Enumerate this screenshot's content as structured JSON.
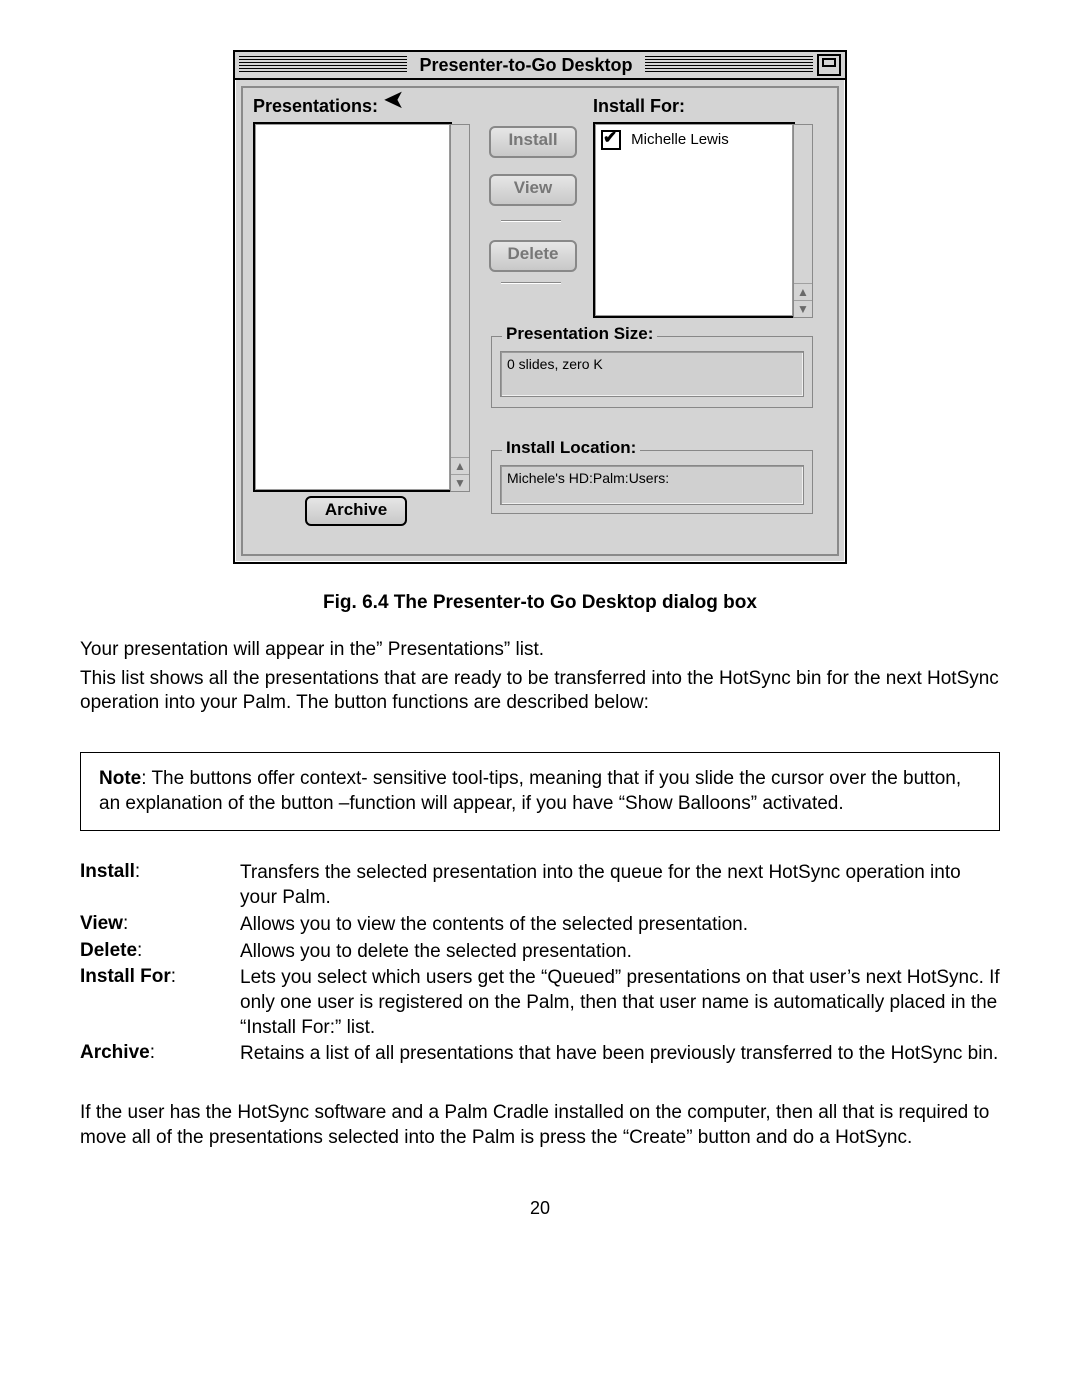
{
  "dialog": {
    "title": "Presenter-to-Go Desktop",
    "labels": {
      "presentations": "Presentations:",
      "install_for": "Install For:",
      "presentation_size": "Presentation Size:",
      "install_location": "Install Location:"
    },
    "buttons": {
      "install": "Install",
      "view": "View",
      "delete": "Delete",
      "archive": "Archive"
    },
    "install_for_user": "Michelle Lewis",
    "size_value": "0 slides, zero K",
    "location_value": "Michele's HD:Palm:Users:"
  },
  "caption": "Fig. 6.4 The Presenter-to Go Desktop dialog box",
  "para1": "Your presentation will appear in the” Presentations” list.",
  "para2": "This list shows all the presentations that are ready to be transferred into the HotSync bin for the next HotSync operation into your Palm.  The button functions are described below:",
  "note_label": "Note",
  "note_body": ":  The buttons offer context- sensitive tool-tips, meaning that if you slide the cursor over the button, an explanation of the button –function will appear, if you have “Show Balloons” activated.",
  "defs": {
    "install": {
      "term": "Install",
      "desc": "Transfers the selected presentation into the queue for the next HotSync operation into your Palm."
    },
    "view": {
      "term": "View",
      "desc": "Allows you to view the contents of the selected presentation."
    },
    "delete": {
      "term": "Delete",
      "desc": "Allows you to delete the selected presentation."
    },
    "install_for": {
      "term": "Install For",
      "desc": "Lets you select which users get the “Queued” presentations on that user’s next HotSync.  If only one user is registered on the Palm, then that user name is automatically placed in the “Install For:” list."
    },
    "archive": {
      "term": "Archive",
      "desc": "Retains a list of all presentations that have been previously transferred to the HotSync bin."
    }
  },
  "closing": "If the user has the HotSync software and a Palm Cradle installed on the computer, then all that is required to move all of the presentations selected into the Palm is press the “Create” button and do a HotSync.",
  "page_number": "20"
}
